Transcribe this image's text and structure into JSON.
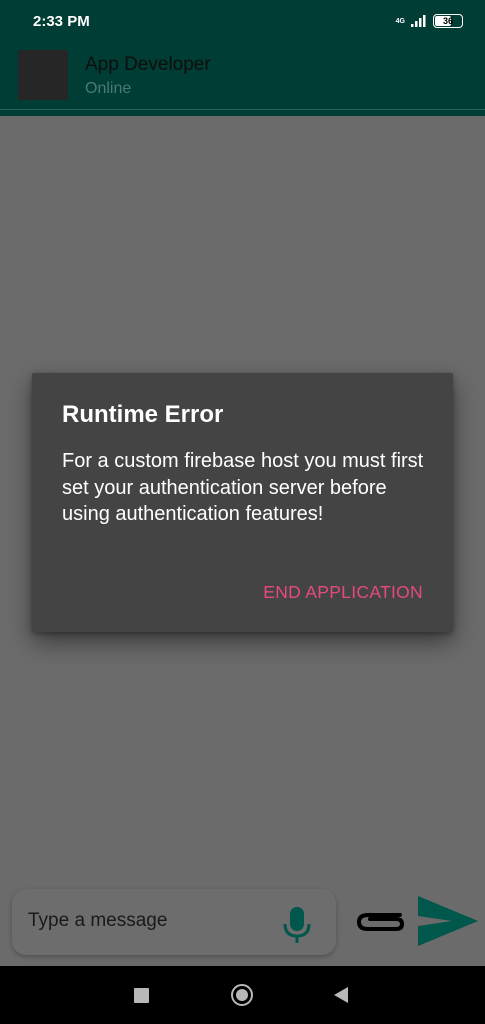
{
  "status_bar": {
    "time": "2:33 PM",
    "network_label": "4G",
    "battery_level": "36"
  },
  "header": {
    "contact_name": "App Developer",
    "contact_status": "Online"
  },
  "dialog": {
    "title": "Runtime Error",
    "message": "For a custom firebase host you must first set your authentication server before using authentication features!",
    "action_label": "END APPLICATION"
  },
  "composer": {
    "placeholder": "Type a message",
    "icons": [
      "mic-icon",
      "paperclip-icon",
      "send-icon"
    ]
  },
  "navigation": {
    "icons": [
      "recent-apps-icon",
      "home-icon",
      "back-icon"
    ]
  },
  "colors": {
    "header_bg": "#003d34",
    "accent": "#e64a7d",
    "icon_green": "#00574b"
  }
}
